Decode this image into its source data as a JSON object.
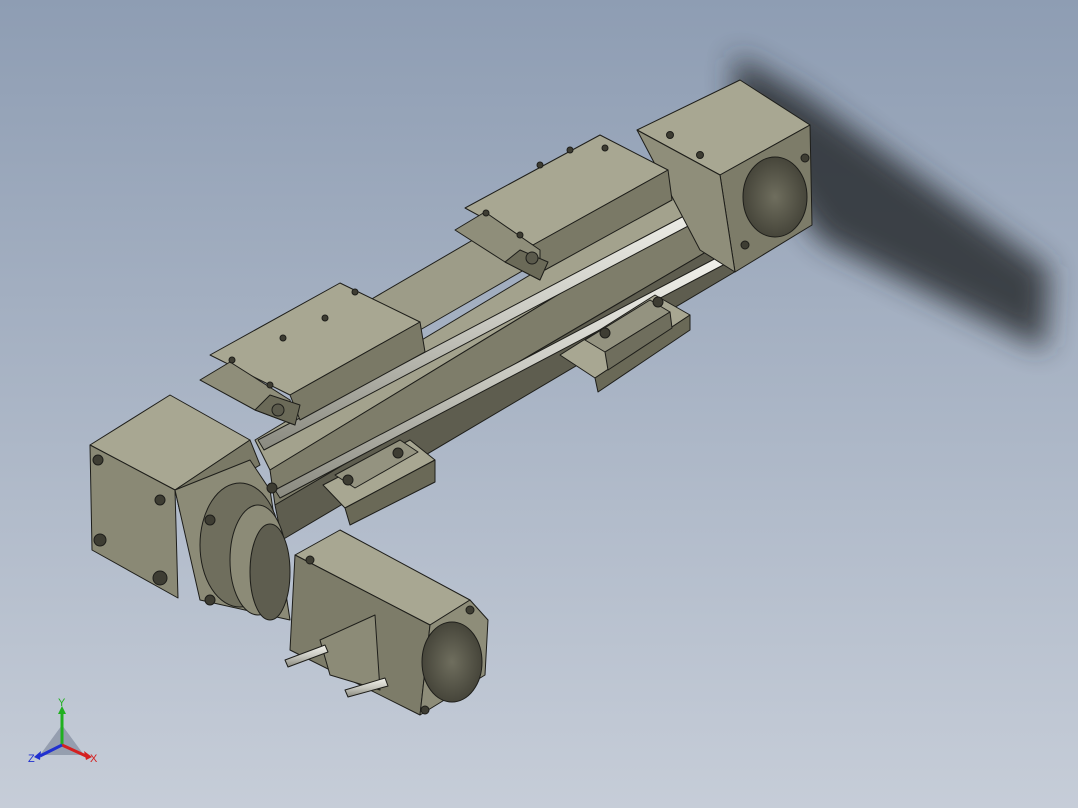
{
  "viewport": {
    "background_top": "#8e9db3",
    "background_bottom": "#c6cdd8"
  },
  "model": {
    "body_color": "#8c8b77",
    "body_dark": "#5b5a4c",
    "body_light": "#a8a792",
    "rod_color": "#d8d8d0",
    "outline_color": "#1e1e1a",
    "shadow_color": "#2b2d33"
  },
  "triad": {
    "x_label": "X",
    "y_label": "Y",
    "z_label": "Z",
    "x_color": "#d42020",
    "y_color": "#20b020",
    "z_color": "#2030d0"
  }
}
